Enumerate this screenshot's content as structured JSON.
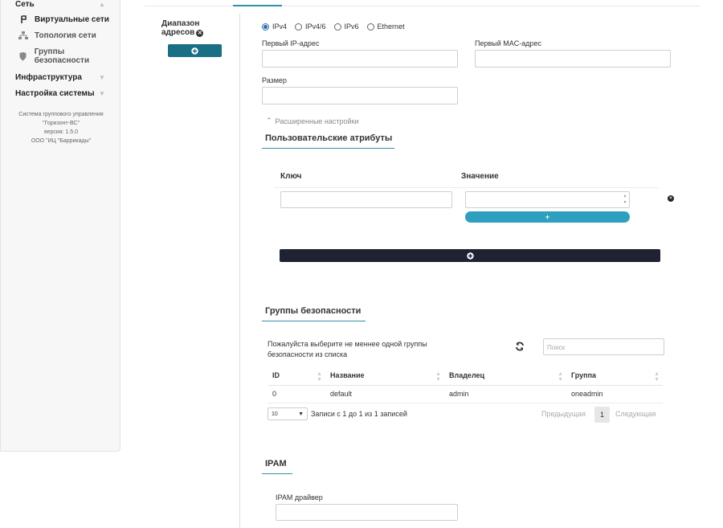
{
  "sidebar": {
    "section_network": "Сеть",
    "items": [
      {
        "label": "Виртуальные сети",
        "icon": "network-icon",
        "active": true
      },
      {
        "label": "Топология сети",
        "icon": "topology-icon",
        "active": false
      },
      {
        "label": "Группы безопасности",
        "icon": "shield-icon",
        "active": false
      }
    ],
    "section_infra": "Инфраструктура",
    "section_settings": "Настройка системы",
    "footer": {
      "line1": "Система группового управления",
      "line2": "\"Горизонт-ВС\"",
      "line3": "версия: 1.5.0",
      "line4": "ООО \"ИЦ \"Баррикады\""
    }
  },
  "range": {
    "label_line1": "Диапазон",
    "label_line2": "адресов",
    "add_icon": "plus-circle-icon"
  },
  "address_types": {
    "options": [
      "IPv4",
      "IPv4/6",
      "IPv6",
      "Ethernet"
    ],
    "selected": "IPv4"
  },
  "fields": {
    "first_ip_label": "Первый IP-адрес",
    "first_ip_value": "",
    "first_mac_label": "Первый MAC-адрес",
    "first_mac_value": "",
    "size_label": "Размер",
    "size_value": ""
  },
  "advanced_label": "Расширенные настройки",
  "custom_attrs": {
    "title": "Пользовательские атрибуты",
    "key_header": "Ключ",
    "value_header": "Значение",
    "add_row_label": "+"
  },
  "security_groups": {
    "title": "Группы безопасности",
    "hint": "Пожалуйста выберите не меннее одной группы безопасности из списка",
    "search_placeholder": "Поиск",
    "columns": [
      "ID",
      "Название",
      "Владелец",
      "Группа"
    ],
    "rows": [
      {
        "id": "0",
        "name": "default",
        "owner": "admin",
        "group": "oneadmin"
      }
    ],
    "page_length": "10",
    "info": "Записи с 1 до 1 из 1 записей",
    "prev": "Предыдущая",
    "page": "1",
    "next": "Следующая"
  },
  "ipam": {
    "title": "IPAM",
    "driver_label": "IPAM драйвер",
    "driver_value": ""
  },
  "colors": {
    "accent": "#2f8fa5",
    "range_button": "#1b6f85",
    "cyan_button": "#2f9fbf",
    "dark_bar": "#1f2233"
  }
}
